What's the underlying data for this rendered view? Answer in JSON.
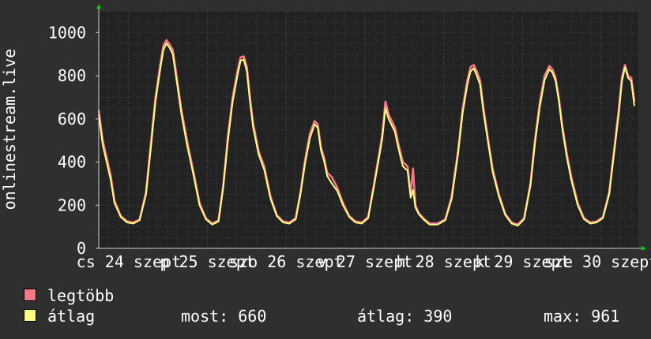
{
  "chart_data": {
    "type": "line",
    "ylabel": "onlinestream.live",
    "ylim": [
      0,
      1100
    ],
    "yticks": [
      0,
      200,
      400,
      600,
      800,
      1000
    ],
    "grid": true,
    "x_tick_labels": [
      "cs 24 szept",
      "p 25 szept",
      "szo 26 szept",
      "v 27 szept",
      "h 28 szept",
      "k 29 szept",
      "sze 30 szept"
    ],
    "x_tick_positions": [
      0.38,
      1.38,
      2.38,
      3.38,
      4.38,
      5.38,
      6.38
    ],
    "xlim": [
      0,
      6.85
    ],
    "series": [
      {
        "name": "legtöbb",
        "color": "#f37a85",
        "x": [
          0,
          0.05,
          0.1,
          0.15,
          0.2,
          0.28,
          0.36,
          0.44,
          0.52,
          0.6,
          0.66,
          0.72,
          0.78,
          0.82,
          0.86,
          0.9,
          0.94,
          0.98,
          1.05,
          1.12,
          1.2,
          1.28,
          1.36,
          1.44,
          1.52,
          1.58,
          1.64,
          1.7,
          1.76,
          1.8,
          1.84,
          1.88,
          1.92,
          1.96,
          2.03,
          2.1,
          2.18,
          2.26,
          2.34,
          2.42,
          2.5,
          2.56,
          2.62,
          2.68,
          2.74,
          2.78,
          2.82,
          2.86,
          2.9,
          2.96,
          3.03,
          3.1,
          3.18,
          3.26,
          3.34,
          3.42,
          3.5,
          3.56,
          3.6,
          3.64,
          3.68,
          3.72,
          3.76,
          3.8,
          3.86,
          3.92,
          3.96,
          3.99,
          4.02,
          4.06,
          4.12,
          4.2,
          4.3,
          4.4,
          4.48,
          4.56,
          4.62,
          4.68,
          4.72,
          4.76,
          4.8,
          4.84,
          4.88,
          4.94,
          5.0,
          5.08,
          5.16,
          5.24,
          5.32,
          5.4,
          5.48,
          5.54,
          5.6,
          5.66,
          5.72,
          5.76,
          5.8,
          5.84,
          5.88,
          5.94,
          6.0,
          6.08,
          6.16,
          6.24,
          6.32,
          6.4,
          6.48,
          6.54,
          6.6,
          6.64,
          6.68,
          6.72,
          6.76,
          6.8
        ],
        "values": [
          640,
          500,
          420,
          340,
          220,
          150,
          125,
          120,
          135,
          260,
          480,
          700,
          850,
          940,
          965,
          945,
          920,
          820,
          640,
          500,
          360,
          210,
          140,
          115,
          130,
          290,
          520,
          700,
          820,
          885,
          890,
          840,
          700,
          580,
          450,
          380,
          240,
          155,
          125,
          120,
          140,
          260,
          410,
          530,
          590,
          575,
          470,
          420,
          350,
          330,
          280,
          210,
          150,
          125,
          120,
          145,
          310,
          440,
          530,
          680,
          620,
          590,
          560,
          490,
          400,
          380,
          250,
          370,
          200,
          165,
          140,
          115,
          115,
          135,
          240,
          450,
          650,
          780,
          840,
          850,
          820,
          780,
          660,
          510,
          370,
          250,
          160,
          120,
          110,
          140,
          300,
          510,
          680,
          800,
          845,
          830,
          790,
          700,
          580,
          440,
          330,
          210,
          140,
          120,
          125,
          145,
          260,
          450,
          640,
          790,
          850,
          800,
          790,
          680
        ]
      },
      {
        "name": "átlag",
        "color": "#fdfd82",
        "x": [
          0,
          0.05,
          0.1,
          0.15,
          0.2,
          0.28,
          0.36,
          0.44,
          0.52,
          0.6,
          0.66,
          0.72,
          0.78,
          0.82,
          0.86,
          0.9,
          0.94,
          0.98,
          1.05,
          1.12,
          1.2,
          1.28,
          1.36,
          1.44,
          1.52,
          1.58,
          1.64,
          1.7,
          1.76,
          1.8,
          1.84,
          1.88,
          1.92,
          1.96,
          2.03,
          2.1,
          2.18,
          2.26,
          2.34,
          2.42,
          2.5,
          2.56,
          2.62,
          2.68,
          2.74,
          2.78,
          2.82,
          2.86,
          2.9,
          2.96,
          3.03,
          3.1,
          3.18,
          3.26,
          3.34,
          3.42,
          3.5,
          3.56,
          3.6,
          3.64,
          3.68,
          3.72,
          3.76,
          3.8,
          3.86,
          3.92,
          3.96,
          3.99,
          4.02,
          4.06,
          4.12,
          4.2,
          4.3,
          4.4,
          4.48,
          4.56,
          4.62,
          4.68,
          4.72,
          4.76,
          4.8,
          4.84,
          4.88,
          4.94,
          5.0,
          5.08,
          5.16,
          5.24,
          5.32,
          5.4,
          5.48,
          5.54,
          5.6,
          5.66,
          5.72,
          5.76,
          5.8,
          5.84,
          5.88,
          5.94,
          6.0,
          6.08,
          6.16,
          6.24,
          6.32,
          6.4,
          6.48,
          6.54,
          6.6,
          6.64,
          6.68,
          6.72,
          6.76,
          6.8
        ],
        "values": [
          620,
          480,
          400,
          320,
          210,
          145,
          120,
          115,
          130,
          250,
          460,
          680,
          830,
          920,
          950,
          930,
          900,
          800,
          620,
          480,
          345,
          200,
          135,
          110,
          125,
          280,
          500,
          680,
          800,
          870,
          875,
          820,
          680,
          560,
          435,
          365,
          230,
          150,
          120,
          115,
          135,
          250,
          395,
          510,
          575,
          560,
          455,
          405,
          335,
          300,
          265,
          200,
          145,
          120,
          115,
          140,
          300,
          425,
          510,
          650,
          600,
          570,
          540,
          470,
          380,
          360,
          235,
          270,
          190,
          160,
          135,
          110,
          110,
          130,
          230,
          435,
          630,
          760,
          820,
          835,
          800,
          760,
          640,
          495,
          355,
          240,
          155,
          115,
          105,
          135,
          290,
          495,
          660,
          780,
          830,
          815,
          775,
          685,
          565,
          425,
          315,
          200,
          135,
          115,
          120,
          140,
          250,
          435,
          620,
          770,
          840,
          790,
          775,
          660
        ]
      }
    ],
    "legend": {
      "placement": "bottom-left"
    },
    "stats": {
      "now": "most: 660",
      "avg": "átlag: 390",
      "max": "max: 961"
    },
    "colors": {
      "background": "#2f2f2f",
      "plot_area": "#222222",
      "grid": "#3d3d3d",
      "grid_major": "#4a4a4a",
      "axis": "#cfcfcf",
      "arrow": "#00cc00",
      "text": "#ffffff"
    }
  }
}
